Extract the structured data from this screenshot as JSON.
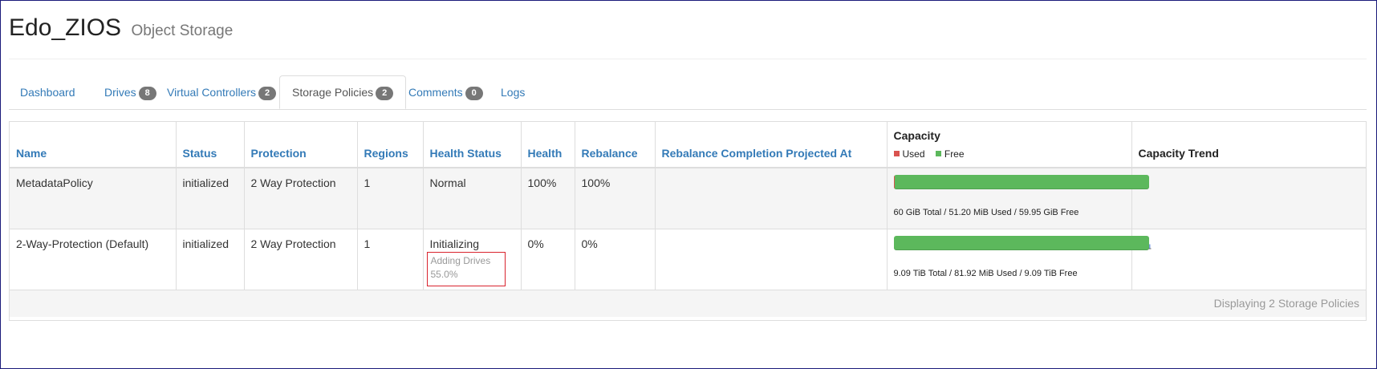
{
  "header": {
    "title": "Edo_ZIOS",
    "subtitle": "Object Storage"
  },
  "tabs": [
    {
      "label": "Dashboard",
      "badge": null
    },
    {
      "label": "Drives",
      "badge": "8"
    },
    {
      "label": "Virtual Controllers",
      "badge": "2"
    },
    {
      "label": "Storage Policies",
      "badge": "2",
      "active": true
    },
    {
      "label": "Comments",
      "badge": "0"
    },
    {
      "label": "Logs",
      "badge": null
    }
  ],
  "table": {
    "columns": {
      "name": "Name",
      "status": "Status",
      "protection": "Protection",
      "regions": "Regions",
      "health_status": "Health Status",
      "health": "Health",
      "rebalance": "Rebalance",
      "rebalance_projected": "Rebalance Completion Projected At",
      "capacity": "Capacity",
      "capacity_trend": "Capacity Trend"
    },
    "legend": {
      "used": "Used",
      "free": "Free",
      "used_color": "#d9534f",
      "free_color": "#5cb85c"
    },
    "rows": [
      {
        "name": "MetadataPolicy",
        "status": "initialized",
        "protection": "2 Way Protection",
        "regions": "1",
        "health_status": "Normal",
        "health_sub_status": "",
        "health_sub_progress": "",
        "health": "100%",
        "rebalance": "100%",
        "rebalance_projected": "",
        "capacity_used_fraction": 0.001,
        "capacity_text": "60 GiB Total / 51.20 MiB Used / 59.95 GiB Free",
        "has_trend_icon": false
      },
      {
        "name": "2-Way-Protection (Default)",
        "status": "initialized",
        "protection": "2 Way Protection",
        "regions": "1",
        "health_status": "Initializing",
        "health_sub_status": "Adding Drives",
        "health_sub_progress": "55.0%",
        "health": "0%",
        "rebalance": "0%",
        "rebalance_projected": "",
        "capacity_used_fraction": 1e-05,
        "capacity_text": "9.09 TiB Total / 81.92 MiB Used / 9.09 TiB Free",
        "has_trend_icon": true
      }
    ],
    "footer": "Displaying 2 Storage Policies"
  },
  "icons": {
    "trend": "bar-chart-icon"
  }
}
